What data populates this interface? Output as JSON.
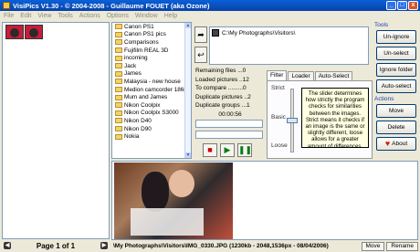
{
  "window": {
    "title": "VisiPics V1.30 - © 2004-2008 - Guillaume FOUET (aka Ozone)",
    "buttons": [
      "_",
      "□",
      "x"
    ]
  },
  "menu": [
    "File",
    "Edit",
    "View",
    "Tools",
    "Actions",
    "Options",
    "Window",
    "Help"
  ],
  "folders": [
    "Canon PS1",
    "Canon PS1 pics",
    "Comparisons",
    "Fujifilm REAL 3D",
    "incoming",
    "Jack",
    "James",
    "Malaysia - new house",
    "Medion camcorder 186i",
    "Mum and James",
    "Nikon Coolpix",
    "Nikon Coolpix S3000",
    "Nikon D40",
    "Nikon D90",
    "Nokia"
  ],
  "path": {
    "value": "C:\\My Photographs\\Visitors\\"
  },
  "stats": {
    "remaining": "Remaining files ...0",
    "loaded": "Loaded pictures ..12",
    "compare": "To compare .........0",
    "duplicates": "Duplicate pictures ..2",
    "groups": "Duplicate groups ...1",
    "timer": "00:00:56"
  },
  "filter": {
    "tabs": [
      "Filter",
      "Loader",
      "Auto-Select"
    ],
    "labels": [
      "Strict",
      "Basic",
      "Loose"
    ],
    "tooltip": "The slider determines how strictly the program checks for similarities between the images. Strict means it checks if an image is the same or slightly different, loose allows for a greater amount of differences.",
    "slider_position": 0.5
  },
  "tools": {
    "title": "Tools",
    "buttons": [
      "Un-ignore",
      "Un-select",
      "Ignore folder",
      "Auto-select"
    ]
  },
  "actions": {
    "title": "Actions",
    "buttons": [
      "Move",
      "Delete",
      "About"
    ]
  },
  "pagination": "Page 1 of 1",
  "status": {
    "text": "\\My Photographs\\Visitors\\IMG_0330.JPG (1230kb - 2048,1536px - 08/04/2006)",
    "move": "Move",
    "rename": "Rename"
  }
}
